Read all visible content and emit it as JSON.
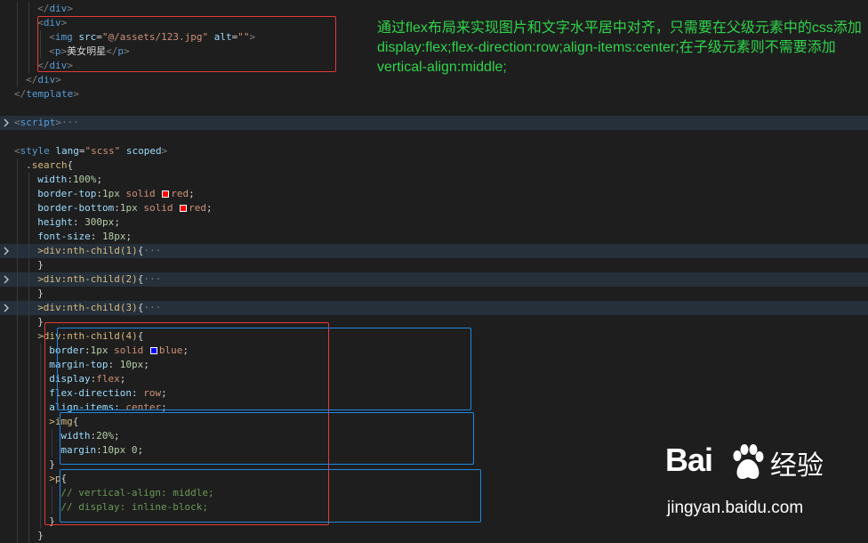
{
  "code": {
    "lines": [
      {
        "fold": false,
        "indent": 4,
        "tokens": [
          [
            "t-punc",
            "</"
          ],
          [
            "t-tag",
            "div"
          ],
          [
            "t-punc",
            ">"
          ]
        ]
      },
      {
        "fold": false,
        "indent": 4,
        "tokens": [
          [
            "t-punc",
            "<"
          ],
          [
            "t-tag",
            "div"
          ],
          [
            "t-punc",
            ">"
          ]
        ]
      },
      {
        "fold": false,
        "indent": 6,
        "tokens": [
          [
            "t-punc",
            "<"
          ],
          [
            "t-tag",
            "img"
          ],
          [
            "t-plain",
            " "
          ],
          [
            "t-attr",
            "src"
          ],
          [
            "t-plain",
            "="
          ],
          [
            "t-str",
            "\"@/assets/123.jpg\""
          ],
          [
            "t-plain",
            " "
          ],
          [
            "t-attr",
            "alt"
          ],
          [
            "t-plain",
            "="
          ],
          [
            "t-str",
            "\"\""
          ],
          [
            "t-punc",
            ">"
          ]
        ]
      },
      {
        "fold": false,
        "indent": 6,
        "tokens": [
          [
            "t-punc",
            "<"
          ],
          [
            "t-tag",
            "p"
          ],
          [
            "t-punc",
            ">"
          ],
          [
            "t-plain",
            "美女明星"
          ],
          [
            "t-punc",
            "</"
          ],
          [
            "t-tag",
            "p"
          ],
          [
            "t-punc",
            ">"
          ]
        ]
      },
      {
        "fold": false,
        "indent": 4,
        "tokens": [
          [
            "t-punc",
            "</"
          ],
          [
            "t-tag",
            "div"
          ],
          [
            "t-punc",
            ">"
          ]
        ]
      },
      {
        "fold": false,
        "indent": 2,
        "tokens": [
          [
            "t-punc",
            "</"
          ],
          [
            "t-tag",
            "div"
          ],
          [
            "t-punc",
            ">"
          ]
        ]
      },
      {
        "fold": false,
        "indent": 0,
        "tokens": [
          [
            "t-punc",
            "</"
          ],
          [
            "t-tag",
            "template"
          ],
          [
            "t-punc",
            ">"
          ]
        ]
      },
      {
        "fold": false,
        "indent": 0,
        "tokens": []
      },
      {
        "fold": true,
        "indent": 0,
        "tokens": [
          [
            "t-punc",
            "<"
          ],
          [
            "t-tag",
            "script"
          ],
          [
            "t-punc",
            ">"
          ],
          [
            "t-punc",
            "···"
          ]
        ]
      },
      {
        "fold": false,
        "indent": 0,
        "tokens": []
      },
      {
        "fold": false,
        "indent": 0,
        "tokens": [
          [
            "t-punc",
            "<"
          ],
          [
            "t-tag",
            "style"
          ],
          [
            "t-plain",
            " "
          ],
          [
            "t-attr",
            "lang"
          ],
          [
            "t-plain",
            "="
          ],
          [
            "t-str",
            "\"scss\""
          ],
          [
            "t-plain",
            " "
          ],
          [
            "t-attr",
            "scoped"
          ],
          [
            "t-punc",
            ">"
          ]
        ]
      },
      {
        "fold": false,
        "indent": 2,
        "tokens": [
          [
            "t-sel",
            ".search"
          ],
          [
            "t-plain",
            "{"
          ]
        ]
      },
      {
        "fold": false,
        "indent": 4,
        "tokens": [
          [
            "t-prop",
            "width"
          ],
          [
            "t-plain",
            ":"
          ],
          [
            "t-num",
            "100%"
          ],
          [
            "t-plain",
            ";"
          ]
        ]
      },
      {
        "fold": false,
        "indent": 4,
        "tokens": [
          [
            "t-prop",
            "border-top"
          ],
          [
            "t-plain",
            ":"
          ],
          [
            "t-num",
            "1px"
          ],
          [
            "t-plain",
            " "
          ],
          [
            "t-val",
            "solid"
          ],
          [
            "t-plain",
            " "
          ],
          [
            "swatch",
            "#ff0000"
          ],
          [
            "t-val",
            "red"
          ],
          [
            "t-plain",
            ";"
          ]
        ]
      },
      {
        "fold": false,
        "indent": 4,
        "tokens": [
          [
            "t-prop",
            "border-bottom"
          ],
          [
            "t-plain",
            ":"
          ],
          [
            "t-num",
            "1px"
          ],
          [
            "t-plain",
            " "
          ],
          [
            "t-val",
            "solid"
          ],
          [
            "t-plain",
            " "
          ],
          [
            "swatch",
            "#ff0000"
          ],
          [
            "t-val",
            "red"
          ],
          [
            "t-plain",
            ";"
          ]
        ]
      },
      {
        "fold": false,
        "indent": 4,
        "tokens": [
          [
            "t-prop",
            "height"
          ],
          [
            "t-plain",
            ": "
          ],
          [
            "t-num",
            "300px"
          ],
          [
            "t-plain",
            ";"
          ]
        ]
      },
      {
        "fold": false,
        "indent": 4,
        "tokens": [
          [
            "t-prop",
            "font-size"
          ],
          [
            "t-plain",
            ": "
          ],
          [
            "t-num",
            "18px"
          ],
          [
            "t-plain",
            ";"
          ]
        ]
      },
      {
        "fold": true,
        "indent": 4,
        "tokens": [
          [
            "t-sel",
            ">div:nth-child(1)"
          ],
          [
            "t-plain",
            "{"
          ],
          [
            "t-punc",
            "···"
          ]
        ]
      },
      {
        "fold": false,
        "indent": 4,
        "tokens": [
          [
            "t-plain",
            "}"
          ]
        ]
      },
      {
        "fold": true,
        "indent": 4,
        "tokens": [
          [
            "t-sel",
            ">div:nth-child(2)"
          ],
          [
            "t-plain",
            "{"
          ],
          [
            "t-punc",
            "···"
          ]
        ]
      },
      {
        "fold": false,
        "indent": 4,
        "tokens": [
          [
            "t-plain",
            "}"
          ]
        ]
      },
      {
        "fold": true,
        "indent": 4,
        "tokens": [
          [
            "t-sel",
            ">div:nth-child(3)"
          ],
          [
            "t-plain",
            "{"
          ],
          [
            "t-punc",
            "···"
          ]
        ]
      },
      {
        "fold": false,
        "indent": 4,
        "tokens": [
          [
            "t-plain",
            "}"
          ]
        ]
      },
      {
        "fold": false,
        "indent": 4,
        "tokens": [
          [
            "t-sel",
            ">div:nth-child(4)"
          ],
          [
            "t-plain",
            "{"
          ]
        ]
      },
      {
        "fold": false,
        "indent": 6,
        "tokens": [
          [
            "t-prop",
            "border"
          ],
          [
            "t-plain",
            ":"
          ],
          [
            "t-num",
            "1px"
          ],
          [
            "t-plain",
            " "
          ],
          [
            "t-val",
            "solid"
          ],
          [
            "t-plain",
            " "
          ],
          [
            "swatch",
            "#0000ff"
          ],
          [
            "t-val",
            "blue"
          ],
          [
            "t-plain",
            ";"
          ]
        ]
      },
      {
        "fold": false,
        "indent": 6,
        "tokens": [
          [
            "t-prop",
            "margin-top"
          ],
          [
            "t-plain",
            ": "
          ],
          [
            "t-num",
            "10px"
          ],
          [
            "t-plain",
            ";"
          ]
        ]
      },
      {
        "fold": false,
        "indent": 6,
        "tokens": [
          [
            "t-prop",
            "display"
          ],
          [
            "t-plain",
            ":"
          ],
          [
            "t-val",
            "flex"
          ],
          [
            "t-plain",
            ";"
          ]
        ]
      },
      {
        "fold": false,
        "indent": 6,
        "tokens": [
          [
            "t-prop",
            "flex-direction"
          ],
          [
            "t-plain",
            ": "
          ],
          [
            "t-val",
            "row"
          ],
          [
            "t-plain",
            ";"
          ]
        ]
      },
      {
        "fold": false,
        "indent": 6,
        "tokens": [
          [
            "t-prop",
            "align-items"
          ],
          [
            "t-plain",
            ": "
          ],
          [
            "t-val",
            "center"
          ],
          [
            "t-plain",
            ";"
          ]
        ]
      },
      {
        "fold": false,
        "indent": 6,
        "tokens": [
          [
            "t-sel",
            ">img"
          ],
          [
            "t-plain",
            "{"
          ]
        ]
      },
      {
        "fold": false,
        "indent": 8,
        "tokens": [
          [
            "t-prop",
            "width"
          ],
          [
            "t-plain",
            ":"
          ],
          [
            "t-num",
            "20%"
          ],
          [
            "t-plain",
            ";"
          ]
        ]
      },
      {
        "fold": false,
        "indent": 8,
        "tokens": [
          [
            "t-prop",
            "margin"
          ],
          [
            "t-plain",
            ":"
          ],
          [
            "t-num",
            "10px 0"
          ],
          [
            "t-plain",
            ";"
          ]
        ]
      },
      {
        "fold": false,
        "indent": 6,
        "tokens": [
          [
            "t-plain",
            "}"
          ]
        ]
      },
      {
        "fold": false,
        "indent": 6,
        "tokens": [
          [
            "t-sel",
            ">p"
          ],
          [
            "t-plain",
            "{"
          ]
        ]
      },
      {
        "fold": false,
        "indent": 8,
        "tokens": [
          [
            "t-cmt",
            "// vertical-align: middle;"
          ]
        ]
      },
      {
        "fold": false,
        "indent": 8,
        "tokens": [
          [
            "t-cmt",
            "// display: inline-block;"
          ]
        ]
      },
      {
        "fold": false,
        "indent": 6,
        "tokens": [
          [
            "t-plain",
            "}"
          ]
        ]
      },
      {
        "fold": false,
        "indent": 4,
        "tokens": [
          [
            "t-plain",
            "}"
          ]
        ]
      }
    ]
  },
  "annotation": {
    "lines": [
      "通过flex布局来实现图片和文字水平居中对齐，只需要在父级元素中的css添加",
      "display:flex;flex-direction:row;align-items:center;在子级元素则不需要添加",
      "vertical-align:middle;"
    ]
  },
  "watermark": {
    "brand": "Bai",
    "brand_suffix": "经验",
    "url": "jingyan.baidu.com"
  },
  "colors": {
    "annotation_text": "#2fd44a",
    "highlight_red": "#e53935",
    "highlight_blue": "#1e88e5"
  }
}
